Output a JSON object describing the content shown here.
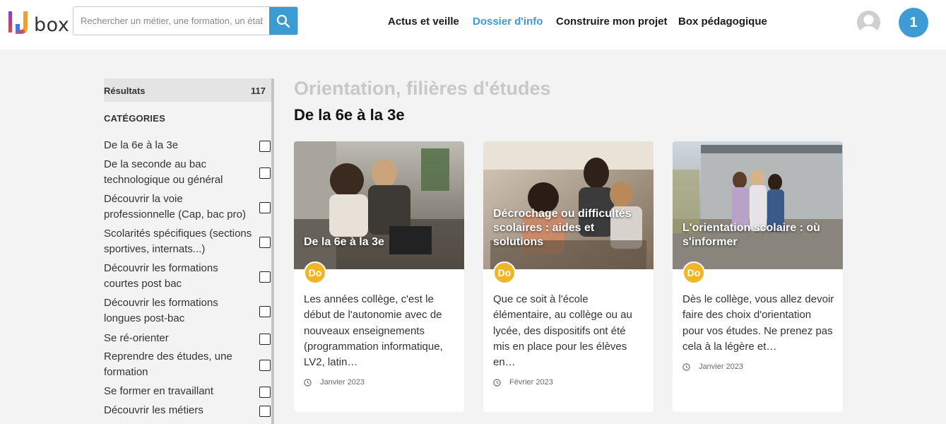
{
  "header": {
    "logo_text": "box",
    "search": {
      "placeholder": "Rechercher un métier, une formation, un établ"
    },
    "nav": [
      "Actus et veille",
      "Dossier d'info",
      "Construire mon projet",
      "Box pédagogique"
    ],
    "active_nav": "Dossier d'info",
    "notification_count": "1",
    "accent_color": "#3a9ad4"
  },
  "sidebar": {
    "results_label": "Résultats",
    "results_count": "117",
    "categories_title": "CATÉGORIES",
    "categories": [
      "De la 6e à la 3e",
      "De la seconde au bac technologique ou général",
      "Découvrir la voie professionnelle (Cap, bac pro)",
      "Scolarités spécifiques (sections sportives, internats...)",
      "Découvrir les formations courtes post bac",
      "Découvrir les formations longues post-bac",
      "Se ré-orienter",
      "Reprendre des études, une formation",
      "Se former en travaillant",
      "Découvrir les métiers"
    ]
  },
  "main": {
    "section_title": "Orientation, filières d'études",
    "subtitle": "De la 6e à la 3e",
    "cards": [
      {
        "caption": "De la 6e à la 3e",
        "badge": "Do",
        "description": "Les années collège, c'est le début de l'autonomie avec de nouveaux enseignements (programmation informatique, LV2, latin…",
        "date": "Janvier 2023"
      },
      {
        "caption": "Décrochage ou difficultés scolaires : aides et solutions",
        "badge": "Do",
        "description": "Que ce soit à l'école élémentaire, au collège ou au lycée, des dispositifs ont été mis en place pour les élèves en…",
        "date": "Février 2023"
      },
      {
        "caption": "L'orientation scolaire : où s'informer",
        "badge": "Do",
        "description": "Dès le collège, vous allez devoir faire des choix d'orientation pour vos études. Ne prenez pas cela à la légère et…",
        "date": "Janvier 2023"
      }
    ],
    "badge_color": "#f0b628"
  }
}
